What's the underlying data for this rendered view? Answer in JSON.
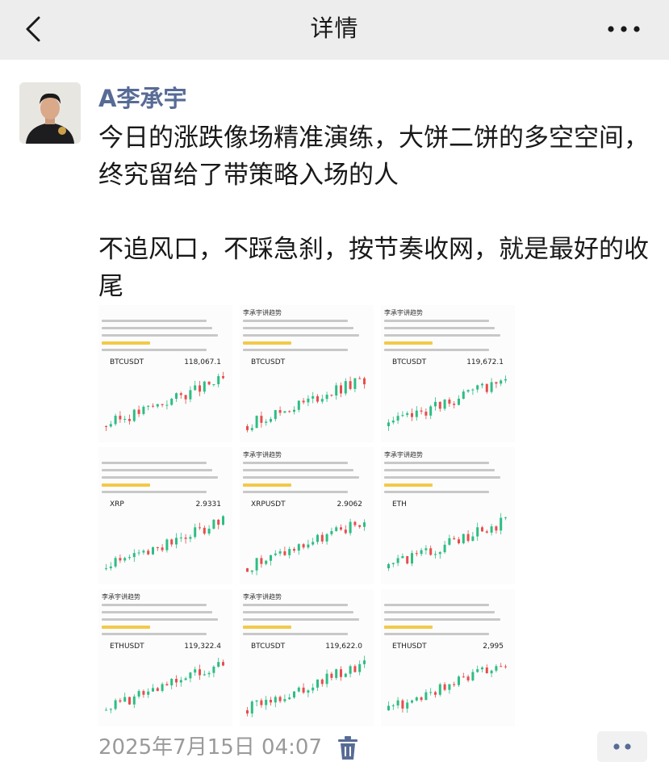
{
  "nav": {
    "title": "详情",
    "back_icon": "chevron-left-icon",
    "more_icon": "more-dots-icon"
  },
  "post": {
    "author": "A李承宇",
    "paragraphs": [
      "今日的涨跌像场精准演练，大饼二饼的多空空间，终究留给了带策略入场的人",
      "不追风口，不踩急刹，按节奏收网，就是最好的收尾"
    ],
    "timestamp": "2025年7月15日 04:07",
    "delete_icon": "trash-icon",
    "comment_icon": "more-dots-icon"
  },
  "images": [
    {
      "header": "",
      "ticker": "BTCUSDT",
      "price": "118,067.1",
      "trend": "up"
    },
    {
      "header": "李承宇讲趋势",
      "ticker": "BTCUSDT",
      "price": "",
      "trend": "up"
    },
    {
      "header": "李承宇讲趋势",
      "ticker": "BTCUSDT",
      "price": "119,672.1",
      "trend": "up"
    },
    {
      "header": "",
      "ticker": "XRP",
      "price": "2.9331",
      "trend": "up"
    },
    {
      "header": "李承宇讲趋势",
      "ticker": "XRPUSDT",
      "price": "2.9062",
      "trend": "up"
    },
    {
      "header": "李承宇讲趋势",
      "ticker": "ETH",
      "price": "",
      "trend": "up"
    },
    {
      "header": "李承宇讲趋势",
      "ticker": "ETHUSDT",
      "price": "119,322.4",
      "trend": "up"
    },
    {
      "header": "李承宇讲趋势",
      "ticker": "BTCUSDT",
      "price": "119,622.0",
      "trend": "up"
    },
    {
      "header": "",
      "ticker": "ETHUSDT",
      "price": "2,995",
      "trend": "up"
    }
  ]
}
